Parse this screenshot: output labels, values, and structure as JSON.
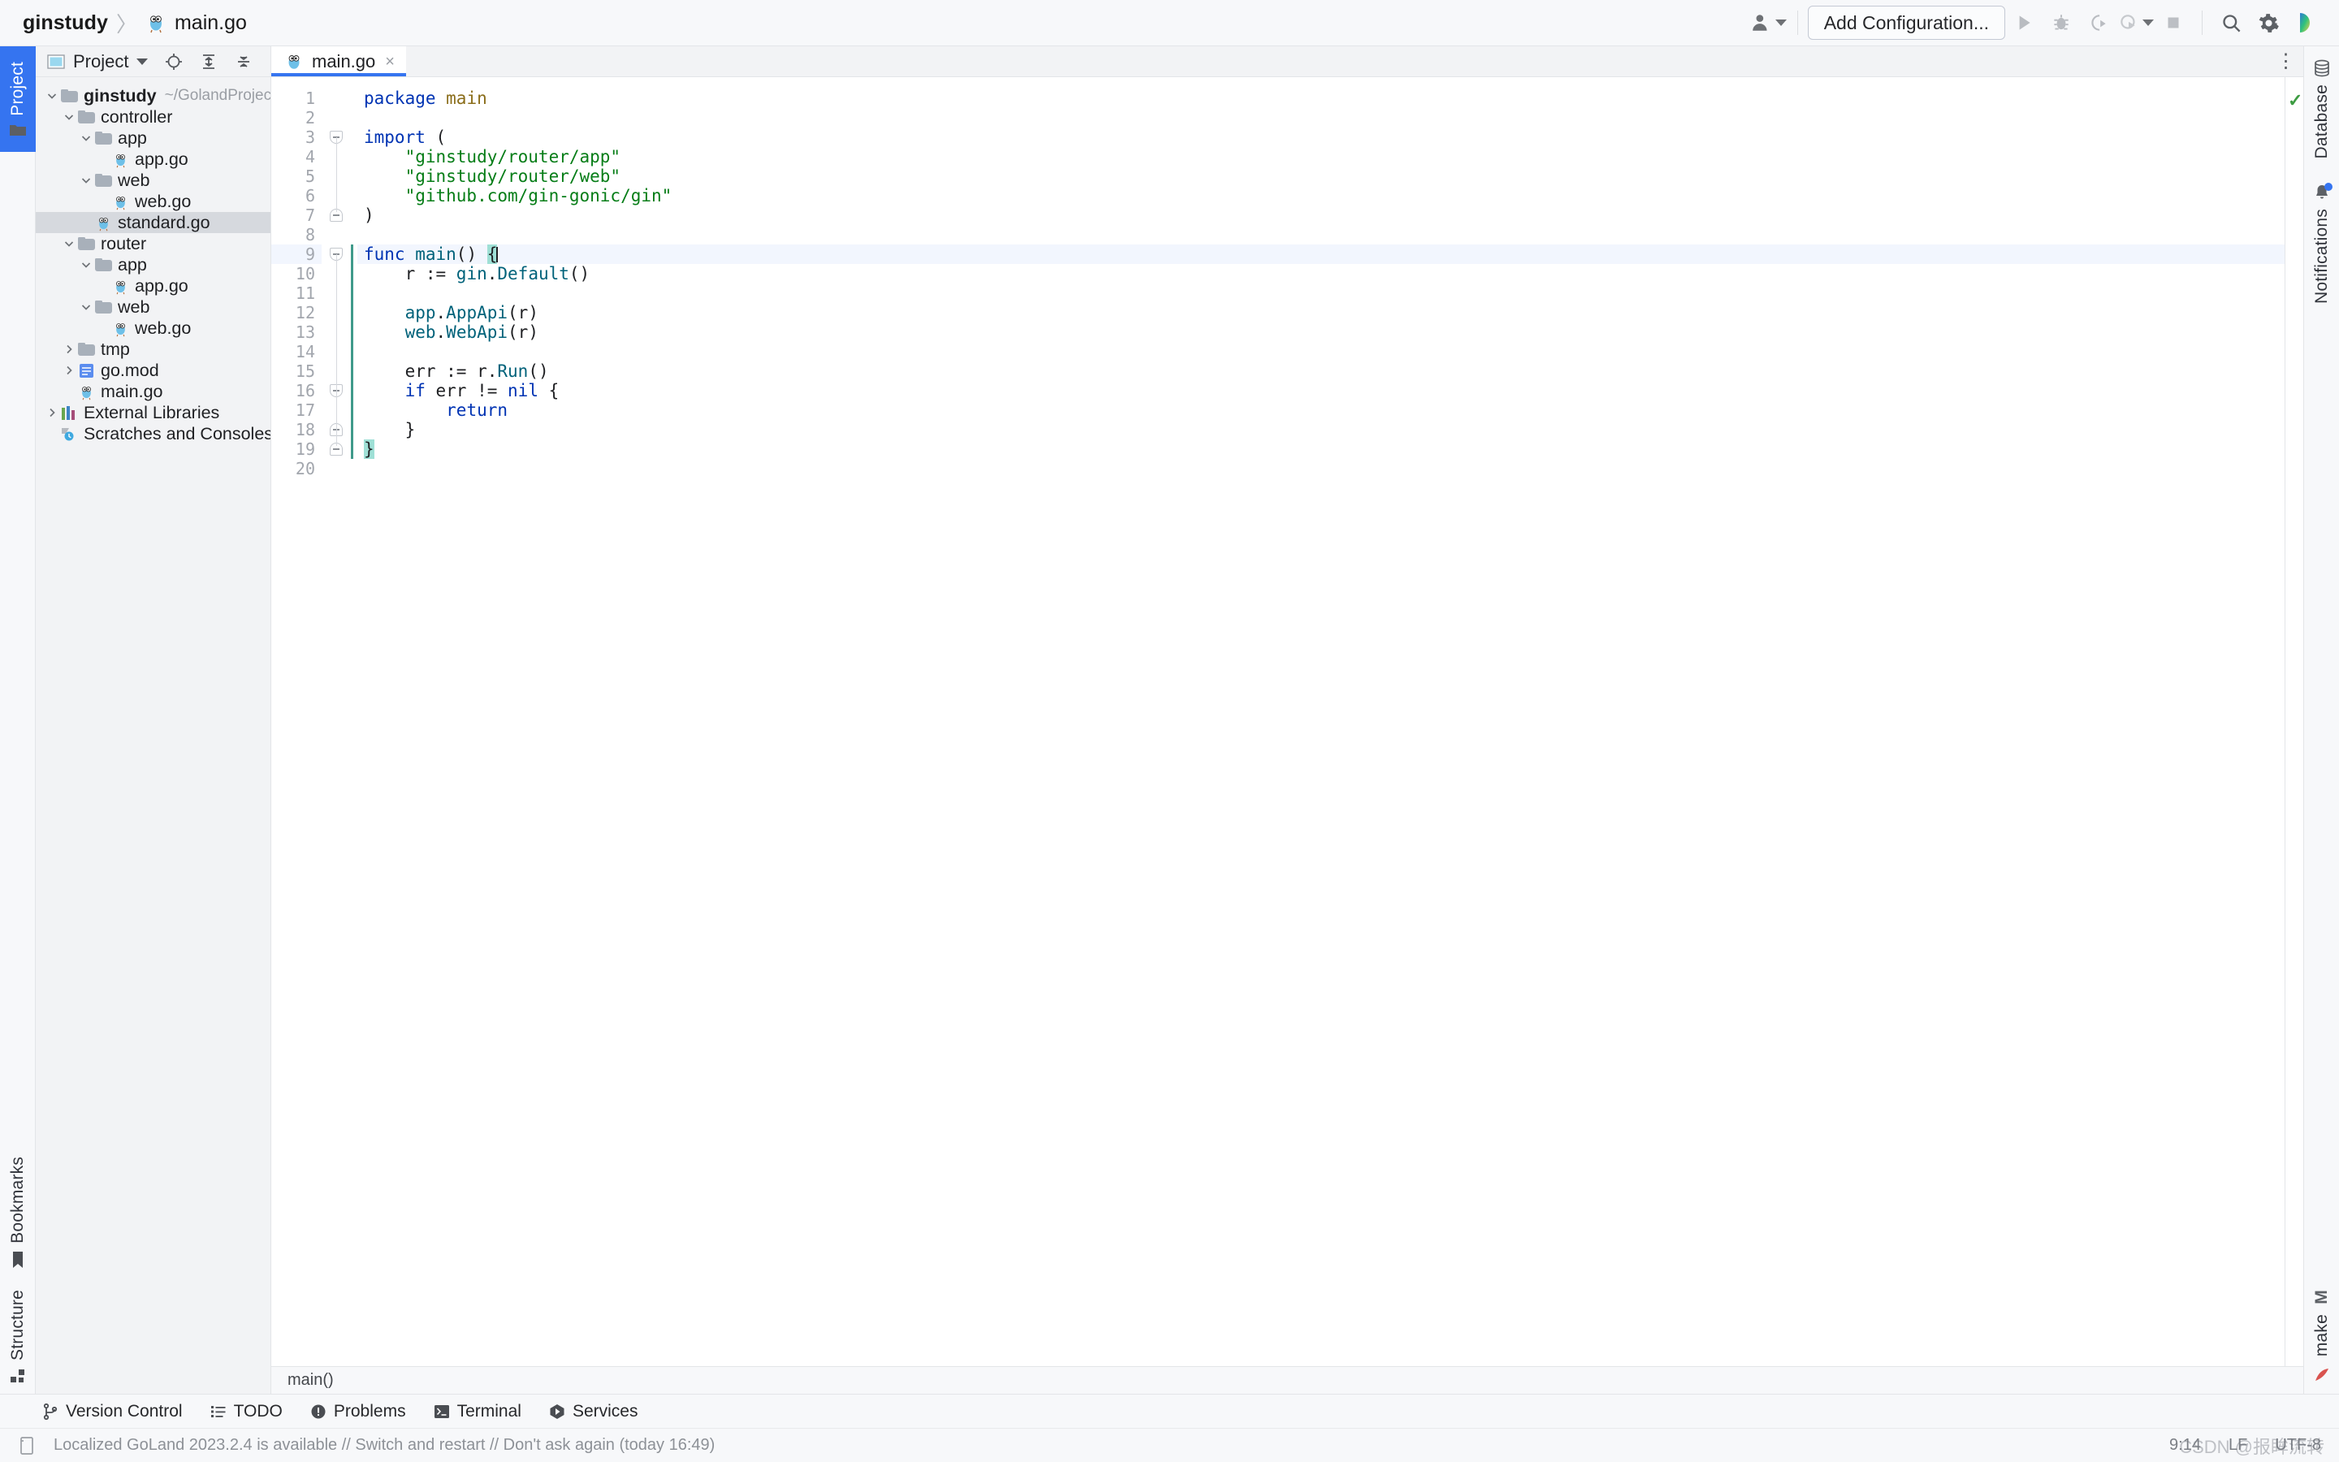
{
  "titlebar": {
    "project_name": "ginstudy",
    "separator": "〉",
    "file_name": "main.go",
    "add_configuration_label": "Add Configuration...",
    "icons": [
      "user-icon",
      "run-icon",
      "debug-icon",
      "run-coverage-icon",
      "profile-icon",
      "stop-icon",
      "search-everywhere-icon",
      "settings-icon",
      "ide-logo-icon"
    ]
  },
  "left_rail": {
    "project_tab": "Project",
    "bookmarks_tab": "Bookmarks",
    "structure_tab": "Structure"
  },
  "project_panel": {
    "title": "Project",
    "toolbar_icons": [
      "locate-icon",
      "expand-all-icon",
      "collapse-all-icon",
      "settings-icon",
      "hide-icon"
    ],
    "tree": [
      {
        "label": "ginstudy",
        "path": "~/GolandProjects/ginstudy",
        "type": "folder",
        "depth": 0,
        "expanded": true,
        "bold": true,
        "selected": false
      },
      {
        "label": "controller",
        "path": "",
        "type": "folder",
        "depth": 1,
        "expanded": true,
        "bold": false,
        "selected": false
      },
      {
        "label": "app",
        "path": "",
        "type": "folder",
        "depth": 2,
        "expanded": true,
        "bold": false,
        "selected": false
      },
      {
        "label": "app.go",
        "path": "",
        "type": "go-file",
        "depth": 3,
        "expanded": null,
        "bold": false,
        "selected": false
      },
      {
        "label": "web",
        "path": "",
        "type": "folder",
        "depth": 2,
        "expanded": true,
        "bold": false,
        "selected": false
      },
      {
        "label": "web.go",
        "path": "",
        "type": "go-file",
        "depth": 3,
        "expanded": null,
        "bold": false,
        "selected": false
      },
      {
        "label": "standard.go",
        "path": "",
        "type": "go-file",
        "depth": 2,
        "expanded": null,
        "bold": false,
        "selected": true
      },
      {
        "label": "router",
        "path": "",
        "type": "folder",
        "depth": 1,
        "expanded": true,
        "bold": false,
        "selected": false
      },
      {
        "label": "app",
        "path": "",
        "type": "folder",
        "depth": 2,
        "expanded": true,
        "bold": false,
        "selected": false
      },
      {
        "label": "app.go",
        "path": "",
        "type": "go-file",
        "depth": 3,
        "expanded": null,
        "bold": false,
        "selected": false
      },
      {
        "label": "web",
        "path": "",
        "type": "folder",
        "depth": 2,
        "expanded": true,
        "bold": false,
        "selected": false
      },
      {
        "label": "web.go",
        "path": "",
        "type": "go-file",
        "depth": 3,
        "expanded": null,
        "bold": false,
        "selected": false
      },
      {
        "label": "tmp",
        "path": "",
        "type": "folder",
        "depth": 1,
        "expanded": false,
        "bold": false,
        "selected": false
      },
      {
        "label": "go.mod",
        "path": "",
        "type": "gomod-file",
        "depth": 1,
        "expanded": false,
        "bold": false,
        "selected": false
      },
      {
        "label": "main.go",
        "path": "",
        "type": "go-file",
        "depth": 1,
        "expanded": null,
        "bold": false,
        "selected": false
      },
      {
        "label": "External Libraries",
        "path": "",
        "type": "library",
        "depth": 0,
        "expanded": false,
        "bold": false,
        "selected": false
      },
      {
        "label": "Scratches and Consoles",
        "path": "",
        "type": "scratches",
        "depth": 0,
        "expanded": null,
        "bold": false,
        "selected": false
      }
    ]
  },
  "editor": {
    "tab_label": "main.go",
    "tab_close": "×",
    "options_menu": "⋮",
    "breadcrumb": "main()",
    "inspection_status": "✓",
    "total_lines": 20,
    "current_line": 9,
    "run_marker_line": 9,
    "lines": [
      {
        "n": 1,
        "tokens": [
          {
            "t": "package ",
            "c": "kw"
          },
          {
            "t": "main",
            "c": "pkg"
          }
        ]
      },
      {
        "n": 2,
        "tokens": []
      },
      {
        "n": 3,
        "tokens": [
          {
            "t": "import",
            "c": "kw"
          },
          {
            "t": " (",
            "c": "id"
          }
        ]
      },
      {
        "n": 4,
        "tokens": [
          {
            "t": "    \"ginstudy/router/app\"",
            "c": "str"
          }
        ]
      },
      {
        "n": 5,
        "tokens": [
          {
            "t": "    \"ginstudy/router/web\"",
            "c": "str"
          }
        ]
      },
      {
        "n": 6,
        "tokens": [
          {
            "t": "    \"github.com/gin-gonic/gin\"",
            "c": "str"
          }
        ]
      },
      {
        "n": 7,
        "tokens": [
          {
            "t": ")",
            "c": "id"
          }
        ]
      },
      {
        "n": 8,
        "tokens": []
      },
      {
        "n": 9,
        "tokens": [
          {
            "t": "func ",
            "c": "kw"
          },
          {
            "t": "main",
            "c": "fn"
          },
          {
            "t": "() ",
            "c": "id"
          },
          {
            "t": "{",
            "c": "brace"
          }
        ]
      },
      {
        "n": 10,
        "tokens": [
          {
            "t": "    r := ",
            "c": "id"
          },
          {
            "t": "gin",
            "c": "fn"
          },
          {
            "t": ".",
            "c": "id"
          },
          {
            "t": "Default",
            "c": "fn"
          },
          {
            "t": "()",
            "c": "id"
          }
        ]
      },
      {
        "n": 11,
        "tokens": []
      },
      {
        "n": 12,
        "tokens": [
          {
            "t": "    ",
            "c": "id"
          },
          {
            "t": "app",
            "c": "fn"
          },
          {
            "t": ".",
            "c": "id"
          },
          {
            "t": "AppApi",
            "c": "fn"
          },
          {
            "t": "(r)",
            "c": "id"
          }
        ]
      },
      {
        "n": 13,
        "tokens": [
          {
            "t": "    ",
            "c": "id"
          },
          {
            "t": "web",
            "c": "fn"
          },
          {
            "t": ".",
            "c": "id"
          },
          {
            "t": "WebApi",
            "c": "fn"
          },
          {
            "t": "(r)",
            "c": "id"
          }
        ]
      },
      {
        "n": 14,
        "tokens": []
      },
      {
        "n": 15,
        "tokens": [
          {
            "t": "    err := r.",
            "c": "id"
          },
          {
            "t": "Run",
            "c": "fn"
          },
          {
            "t": "()",
            "c": "id"
          }
        ]
      },
      {
        "n": 16,
        "tokens": [
          {
            "t": "    ",
            "c": "id"
          },
          {
            "t": "if",
            "c": "kw"
          },
          {
            "t": " err != ",
            "c": "id"
          },
          {
            "t": "nil",
            "c": "kw"
          },
          {
            "t": " {",
            "c": "id"
          }
        ]
      },
      {
        "n": 17,
        "tokens": [
          {
            "t": "        ",
            "c": "id"
          },
          {
            "t": "return",
            "c": "kw"
          }
        ]
      },
      {
        "n": 18,
        "tokens": [
          {
            "t": "    }",
            "c": "id"
          }
        ]
      },
      {
        "n": 19,
        "tokens": [
          {
            "t": "}",
            "c": "brace"
          }
        ]
      },
      {
        "n": 20,
        "tokens": []
      }
    ]
  },
  "right_rail": {
    "database_tab": "Database",
    "notifications_tab": "Notifications",
    "make_tab": "make",
    "maven_badge": "M"
  },
  "toolstrip": {
    "items": [
      {
        "label": "Version Control",
        "icon": "branch-icon"
      },
      {
        "label": "TODO",
        "icon": "list-icon"
      },
      {
        "label": "Problems",
        "icon": "warning-icon"
      },
      {
        "label": "Terminal",
        "icon": "terminal-icon"
      },
      {
        "label": "Services",
        "icon": "services-icon"
      }
    ]
  },
  "statusbar": {
    "notification_icon": "notification-icon",
    "message": "Localized GoLand 2023.2.4 is available // Switch and restart // Don't ask again (today 16:49)",
    "caret_position": "9:14",
    "line_separator": "LF",
    "encoding": "UTF-8",
    "watermark": "CSDN @报眸流转"
  },
  "colors": {
    "accent": "#3574f0",
    "keyword": "#0033b3",
    "string": "#067d17",
    "function": "#00627a",
    "package": "#8a6d1a",
    "selection": "#d6d9de",
    "current_line": "#f2f6fe",
    "brace_highlight": "#9fe0d6",
    "run_green": "#4caf50"
  }
}
